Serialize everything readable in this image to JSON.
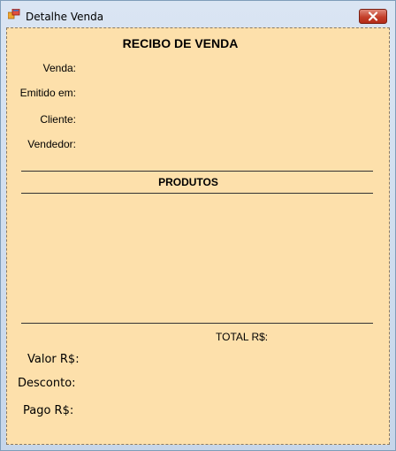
{
  "window": {
    "title": "Detalhe Venda",
    "close_icon": "close-icon",
    "app_icon": "windows-forms-app-icon"
  },
  "receipt": {
    "title": "RECIBO DE VENDA",
    "fields": {
      "venda": "Venda:",
      "emitido_em": "Emitido em:",
      "cliente": "Cliente:",
      "vendedor": "Vendedor:"
    },
    "products_header": "PRODUTOS",
    "products": [],
    "total_label": "TOTAL R$:",
    "summary": {
      "valor": "Valor R$:",
      "desconto": "Desconto:",
      "pago": "Pago R$:"
    }
  },
  "colors": {
    "form_background": "#fde0ab",
    "close_button": "#c4402b"
  }
}
